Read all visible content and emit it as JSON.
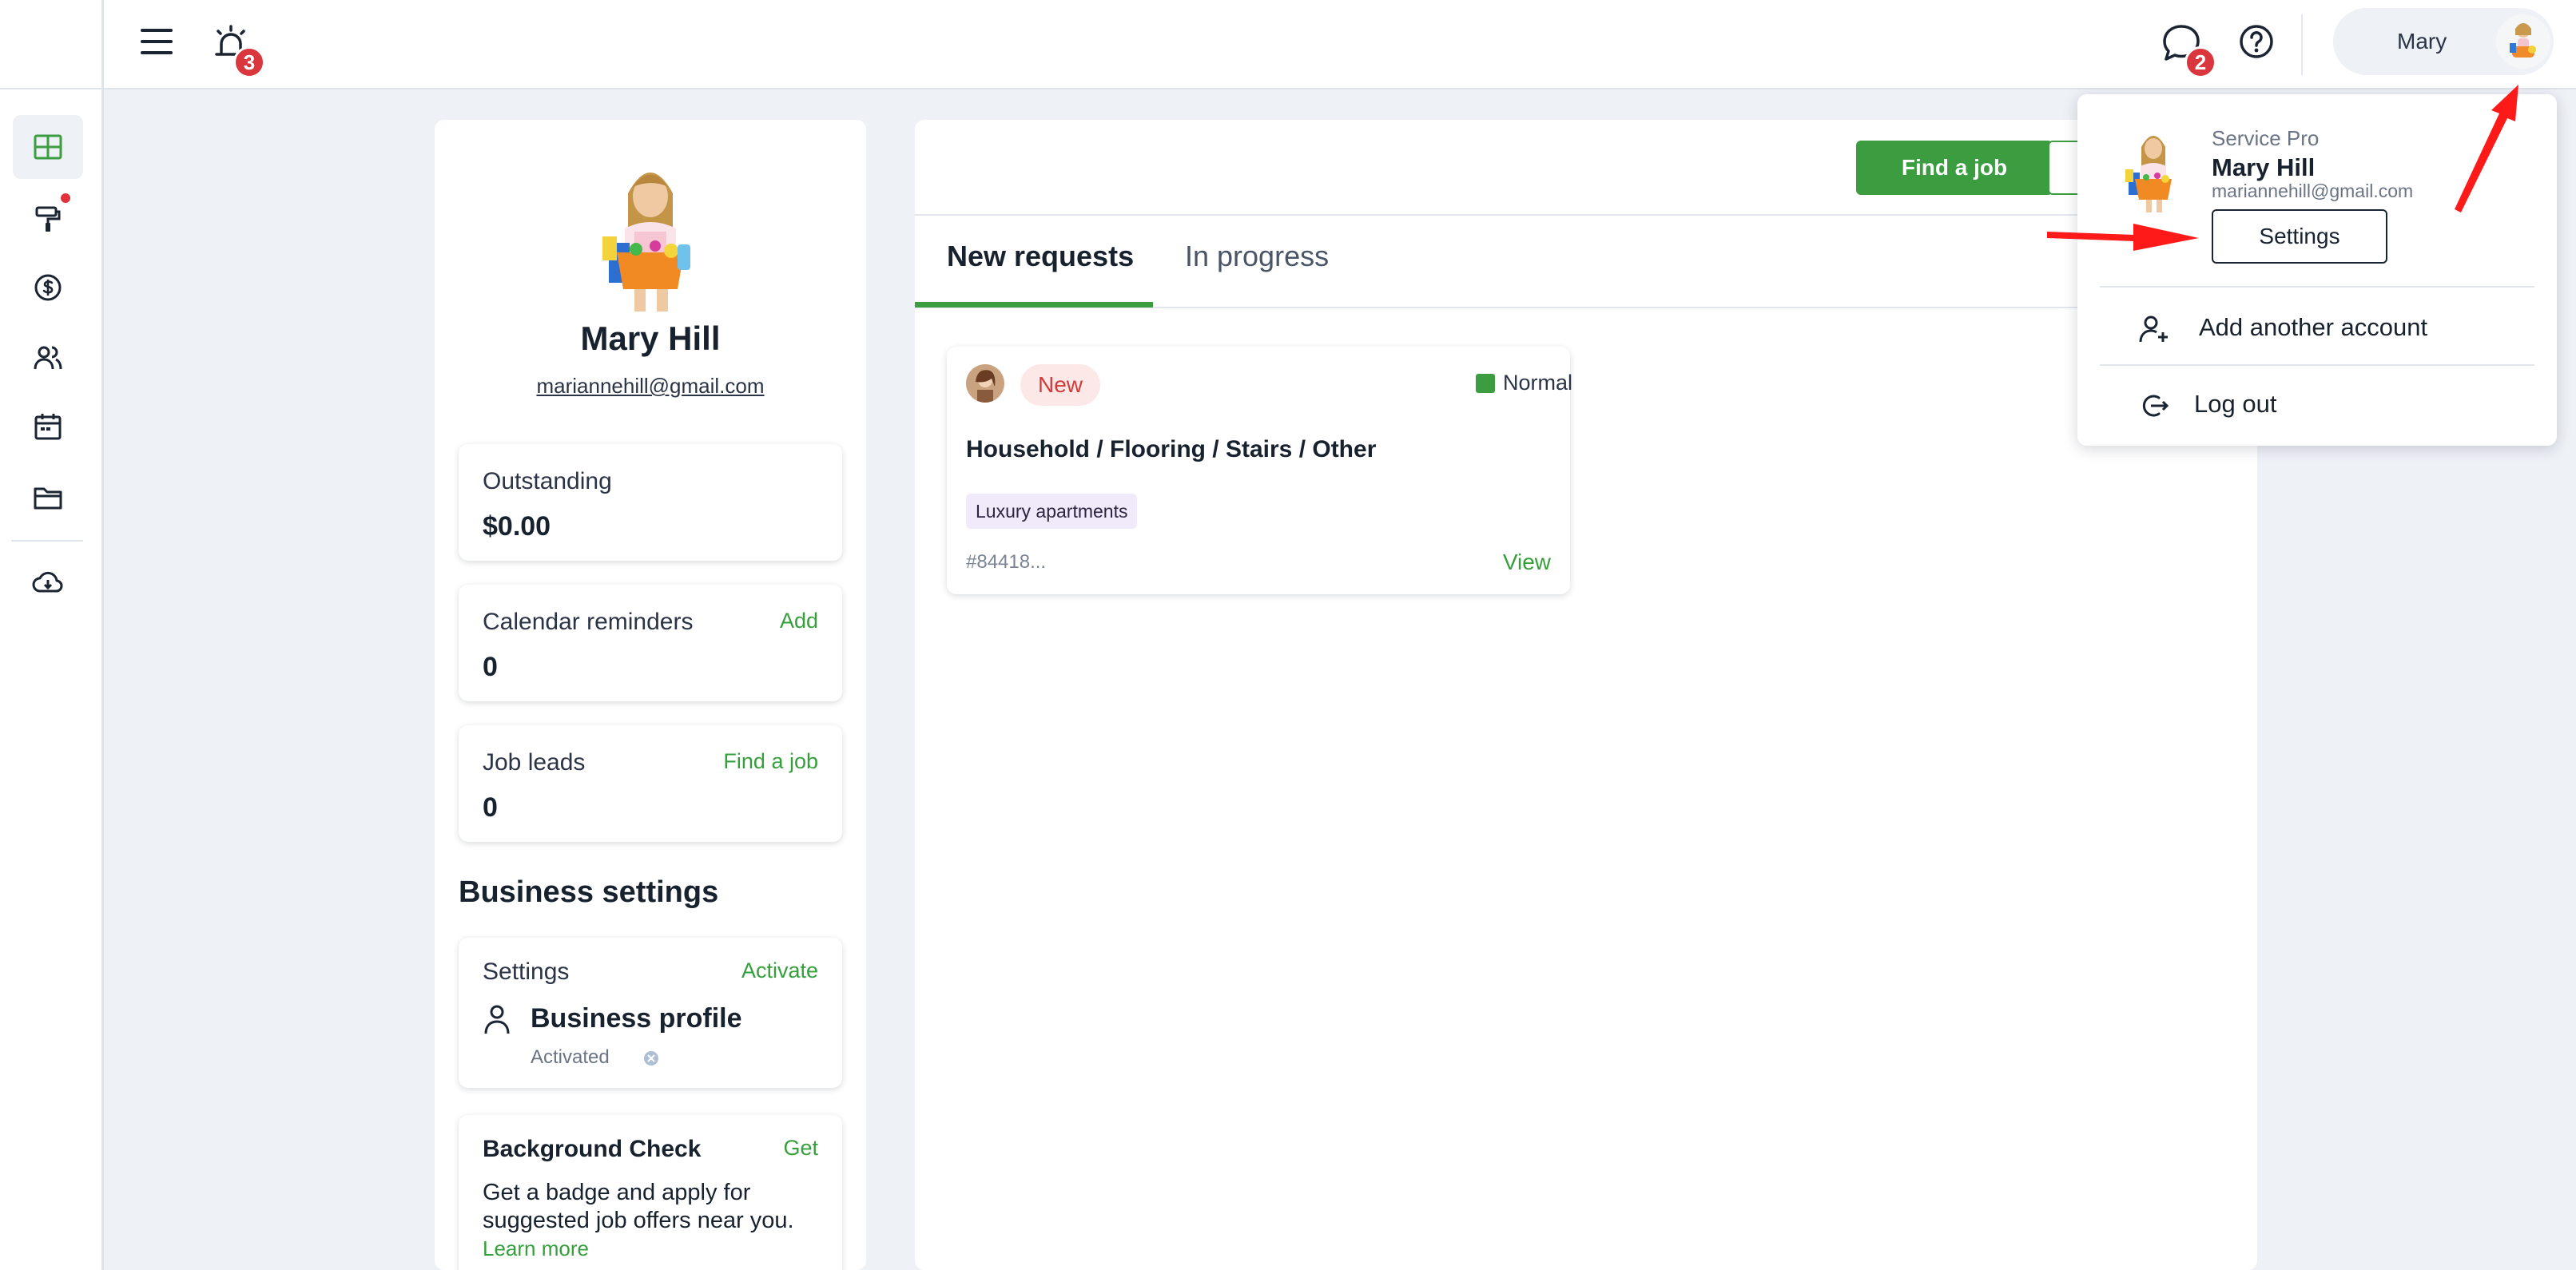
{
  "topbar": {
    "alarm_badge": "3",
    "chat_badge": "2",
    "user_name": "Mary"
  },
  "profile": {
    "name": "Mary Hill",
    "email": "mariannehill@gmail.com"
  },
  "cards": {
    "outstanding": {
      "title": "Outstanding",
      "value": "$0.00"
    },
    "calendar": {
      "title": "Calendar reminders",
      "link": "Add",
      "value": "0"
    },
    "leads": {
      "title": "Job leads",
      "link": "Find a job",
      "value": "0"
    }
  },
  "business": {
    "section_title": "Business settings",
    "settings_title": "Settings",
    "settings_link": "Activate",
    "profile_label": "Business profile",
    "profile_status": "Activated",
    "bg_title": "Background Check",
    "bg_link": "Get",
    "bg_text": "Get a badge and apply for suggested job offers near you.",
    "bg_learn_more": "Learn more"
  },
  "main": {
    "find_job_button": "Find a job",
    "tabs": [
      {
        "label": "New requests"
      },
      {
        "label": "In progress"
      }
    ],
    "job": {
      "status": "New",
      "priority": "Normal",
      "title": "Household / Flooring / Stairs / Other",
      "tag": "Luxury apartments",
      "id": "#84418...",
      "view": "View"
    }
  },
  "dropdown": {
    "role": "Service Pro",
    "name": "Mary Hill",
    "email": "mariannehill@gmail.com",
    "settings_button": "Settings",
    "add_account": "Add another account",
    "log_out": "Log out"
  },
  "colors": {
    "accent_green": "#3b9d3f",
    "badge_red": "#d9363e",
    "annotation_red": "#ff1a1a"
  },
  "icons": {
    "menu": "hamburger-icon",
    "alarm": "alarm-bell-icon",
    "chat": "chat-bubble-icon",
    "help": "question-circle-icon"
  }
}
